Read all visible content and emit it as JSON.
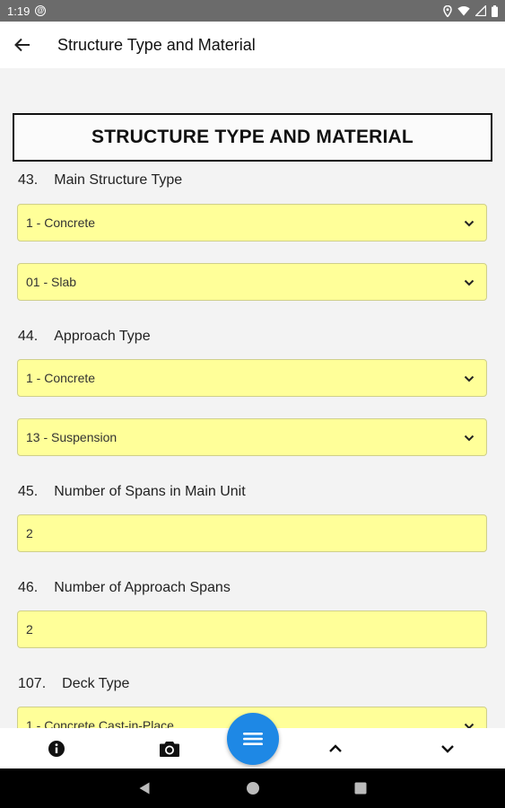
{
  "status_bar": {
    "time": "1:19",
    "icons": [
      "at-sign-icon",
      "location-icon",
      "wifi-icon",
      "signal-icon",
      "battery-icon"
    ]
  },
  "app_bar": {
    "title": "Structure Type and Material",
    "back_icon": "arrow-back-icon"
  },
  "section": {
    "header": "STRUCTURE TYPE AND MATERIAL"
  },
  "fields": {
    "f43": {
      "number": "43.",
      "label": "Main Structure Type",
      "select1": "1 - Concrete",
      "select2": "01 - Slab"
    },
    "f44": {
      "number": "44.",
      "label": "Approach Type",
      "select1": "1 - Concrete",
      "select2": "13 - Suspension"
    },
    "f45": {
      "number": "45.",
      "label": "Number of Spans in Main Unit",
      "value": "2"
    },
    "f46": {
      "number": "46.",
      "label": "Number of Approach Spans",
      "value": "2"
    },
    "f107": {
      "number": "107.",
      "label": "Deck Type",
      "select1": "1 - Concrete Cast-in-Place"
    }
  },
  "colors": {
    "field_bg": "#ffff99",
    "fab": "#1e88e5",
    "status_bar": "#6b6b6b"
  },
  "toolbar": {
    "icons": [
      "info-icon",
      "camera-icon",
      "menu-icon",
      "chevron-up-icon",
      "chevron-down-icon"
    ]
  },
  "nav_bar": {
    "icons": [
      "nav-back-icon",
      "nav-home-icon",
      "nav-recents-icon"
    ]
  }
}
